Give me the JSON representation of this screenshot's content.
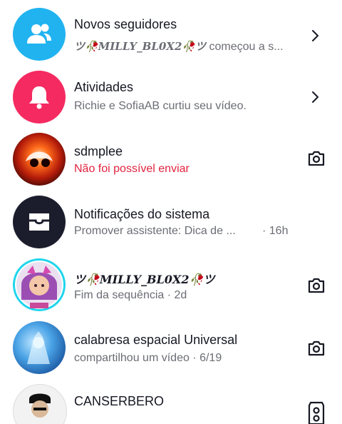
{
  "colors": {
    "accent_blue": "#20b3f0",
    "accent_pink": "#f52a61",
    "error": "#e1233f",
    "dark": "#1b1d2c"
  },
  "rows": [
    {
      "title": "Novos seguidores",
      "subtitle_name": "ツ🥀MILLY_BL0X2🥀ツ",
      "subtitle_rest": " começou a s...",
      "icon": "followers-icon",
      "action": "chevron-right-icon"
    },
    {
      "title": "Atividades",
      "subtitle": "Richie e SofiaAB curtiu seu vídeo.",
      "icon": "bell-icon",
      "action": "chevron-right-icon"
    },
    {
      "title": "sdmplee",
      "subtitle": "Não foi possível enviar",
      "action": "camera-icon"
    },
    {
      "title": "Notificações do sistema",
      "subtitle": "Promover assistente: Dica de ...",
      "time": "· 16h",
      "icon": "inbox-icon"
    },
    {
      "title": "ツ🥀MILLY_BL0X2🥀ツ",
      "subtitle": "Fim da sequência · 2d",
      "action": "camera-icon"
    },
    {
      "title": "calabresa espacial Universal",
      "subtitle": "compartilhou um vídeo · 6/19",
      "action": "camera-icon"
    },
    {
      "title": "CANSERBERO",
      "action": "camera-icon"
    }
  ]
}
